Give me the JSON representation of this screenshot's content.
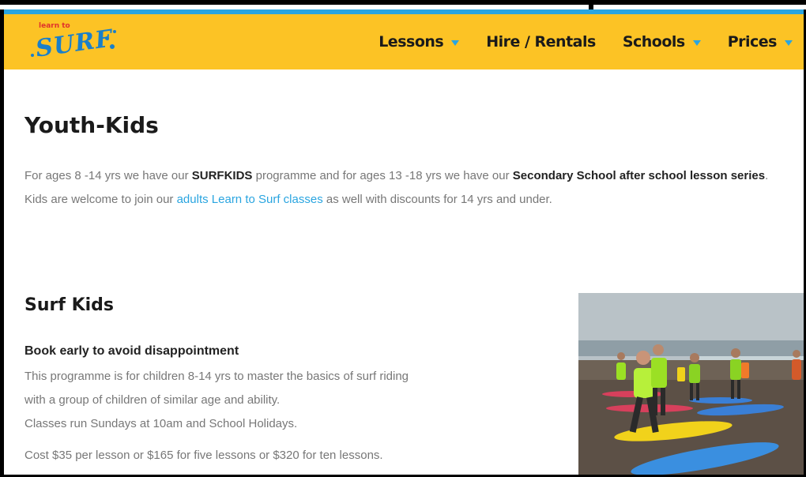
{
  "logo": {
    "small_text": "learn to",
    "big_text": "SURF"
  },
  "nav": {
    "items": [
      {
        "label": "Lessons",
        "has_dropdown": true
      },
      {
        "label": "Hire / Rentals",
        "has_dropdown": false
      },
      {
        "label": "Schools",
        "has_dropdown": true
      },
      {
        "label": "Prices",
        "has_dropdown": true
      }
    ]
  },
  "page": {
    "title": "Youth-Kids",
    "intro": {
      "part1": "For ages 8 -14 yrs we have our ",
      "bold1": "SURFKIDS",
      "part2": " programme and for ages 13 -18 yrs we have our ",
      "bold2": "Secondary School after school lesson series",
      "part3": ". Kids are welcome to join our ",
      "link": "adults Learn to Surf classes",
      "part4": " as well with discounts for 14 yrs and under."
    }
  },
  "surf_kids": {
    "title": "Surf Kids",
    "book_early": "Book early to avoid disappointment",
    "desc_line1": "This programme is for children 8-14 yrs to master the basics of surf riding",
    "desc_line2": "with a group of children of similar age and ability.",
    "desc_line3": "Classes run Sundays at 10am and School Holidays.",
    "cost": "Cost $35 per lesson or $165 for five lessons or $320 for ten lessons."
  },
  "colors": {
    "header_bg": "#fcc325",
    "accent_blue": "#2aa5e0",
    "text_grey": "#777777"
  }
}
